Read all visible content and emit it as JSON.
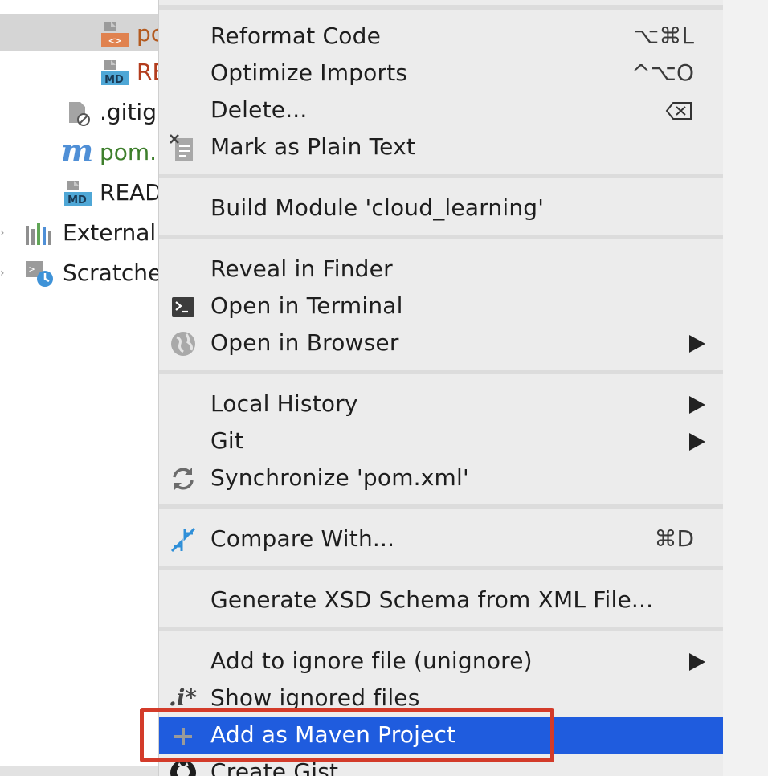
{
  "project_tree": {
    "items": [
      {
        "name": "pom-xml-file-truncated",
        "label": "pc",
        "color": "#b35a1f",
        "icon": "xml-file-icon",
        "selected": true
      },
      {
        "name": "readme-file-truncated",
        "label": "RE",
        "color": "#b33d1e",
        "icon": "markdown-file-icon"
      },
      {
        "name": "gitignore-file",
        "label": ".gitig",
        "color": "#1e1e1e",
        "icon": "ignored-file-icon"
      },
      {
        "name": "pom-maven-file",
        "label": "pom.",
        "color": "#3e7f2c",
        "icon": "maven-icon"
      },
      {
        "name": "readme-file",
        "label": "READ",
        "color": "#1e1e1e",
        "icon": "markdown-file-icon"
      },
      {
        "name": "external-libraries",
        "label": "External",
        "color": "#1e1e1e",
        "icon": "libraries-icon"
      },
      {
        "name": "scratches",
        "label": "Scratche",
        "color": "#1e1e1e",
        "icon": "scratches-icon"
      }
    ]
  },
  "context_menu": {
    "items": [
      {
        "id": "reformat-code",
        "label": "Reformat Code",
        "shortcut": "⌥⌘L"
      },
      {
        "id": "optimize-imports",
        "label": "Optimize Imports",
        "shortcut": "^⌥O"
      },
      {
        "id": "delete",
        "label": "Delete...",
        "shortcut_icon": "delete-key-icon"
      },
      {
        "id": "mark-plain-text",
        "label": "Mark as Plain Text",
        "icon": "plain-text-icon"
      },
      {
        "id": "build-module",
        "label": "Build Module 'cloud_learning'"
      },
      {
        "id": "reveal-finder",
        "label": "Reveal in Finder"
      },
      {
        "id": "open-terminal",
        "label": "Open in Terminal",
        "icon": "terminal-icon"
      },
      {
        "id": "open-browser",
        "label": "Open in Browser",
        "icon": "globe-icon",
        "submenu": true
      },
      {
        "id": "local-history",
        "label": "Local History",
        "submenu": true
      },
      {
        "id": "git",
        "label": "Git",
        "submenu": true
      },
      {
        "id": "synchronize",
        "label": "Synchronize 'pom.xml'",
        "icon": "sync-icon"
      },
      {
        "id": "compare-with",
        "label": "Compare With...",
        "icon": "compare-icon",
        "shortcut": "⌘D"
      },
      {
        "id": "generate-xsd",
        "label": "Generate XSD Schema from XML File..."
      },
      {
        "id": "add-to-ignore",
        "label": "Add to ignore file (unignore)",
        "submenu": true
      },
      {
        "id": "show-ignored",
        "label": "Show ignored files",
        "icon": "ignored-files-icon"
      },
      {
        "id": "add-maven-project",
        "label": "Add as Maven Project",
        "icon": "plus-icon",
        "active": true
      },
      {
        "id": "create-gist",
        "label": "Create Gist...",
        "icon": "github-icon"
      }
    ]
  },
  "colors": {
    "menu_background": "#ececec",
    "active_item": "#1f5cde",
    "annotation_box": "#d33b2a",
    "tree_selection": "#d5d5d5"
  }
}
